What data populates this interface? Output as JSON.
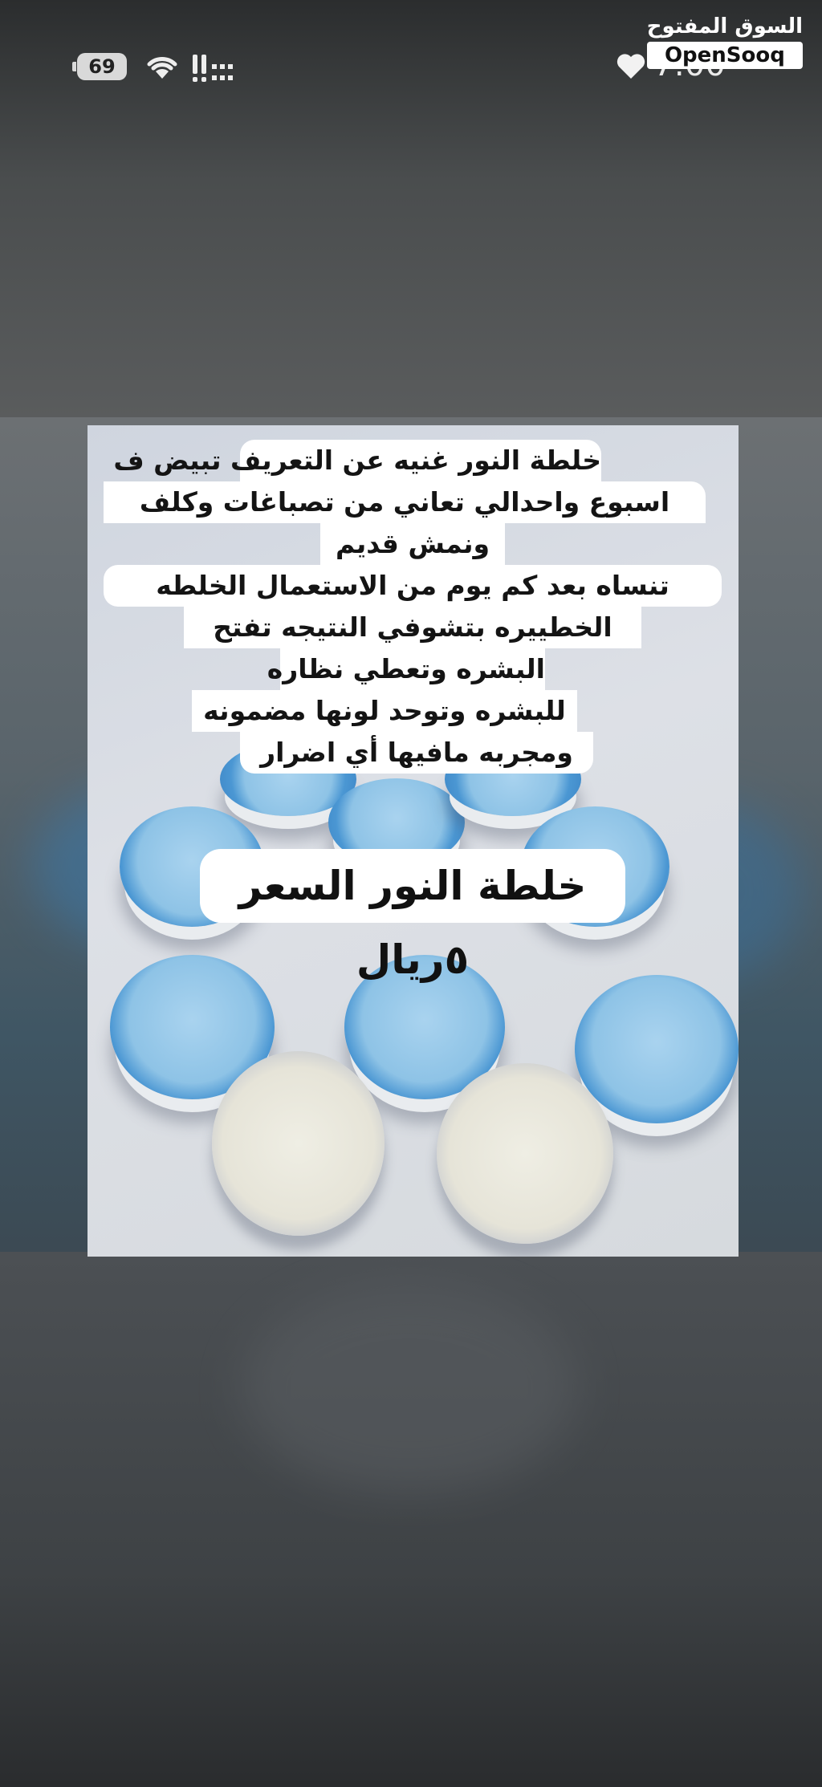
{
  "status_bar": {
    "battery": "69",
    "time": "7:00",
    "icons": [
      "battery-icon",
      "wifi-icon",
      "signal-icon",
      "heart-icon"
    ]
  },
  "brand": {
    "arabic": "السوق المفتوح",
    "english": "OpenSooq"
  },
  "image": {
    "description_lines": [
      "خلطة النور غنيه عن التعريف تبيض ف",
      "اسبوع واحدالي تعاني من تصباغات وكلف",
      "ونمش قديم",
      "تنساه بعد كم يوم من الاستعمال الخلطه",
      "الخطييره بتشوفي النتيجه تفتح",
      "البشره وتعطي نظاره",
      "للبشره وتوحد لونها مضمونه",
      "ومجربه مافيها أي اضرار"
    ],
    "price_label": "خلطة النور السعر ٥ريال"
  },
  "colors": {
    "jar_blue": "#8ec3e6",
    "jar_rim": "#3a83c4",
    "cream": "#e6e4d8",
    "backdrop": "#3d4448"
  }
}
